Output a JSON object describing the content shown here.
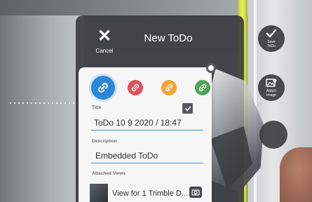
{
  "header": {
    "title": "New ToDo",
    "cancel_label": "Cancel"
  },
  "colors": [
    {
      "name": "link-blue",
      "hex": "#2d86d8",
      "selected": true
    },
    {
      "name": "link-red",
      "hex": "#e0505a",
      "selected": false
    },
    {
      "name": "link-orange",
      "hex": "#f0a332",
      "selected": false
    },
    {
      "name": "link-green",
      "hex": "#52a35a",
      "selected": false
    }
  ],
  "form": {
    "title_label": "Title",
    "title_value": "ToDo 10 9 2020 / 18:47",
    "description_label": "Description",
    "description_value": "Embedded ToDo",
    "attached_label": "Attached Views",
    "attached_item": "View for 1 Trimble D..."
  },
  "side_actions": {
    "save_label_line1": "Save",
    "save_label_line2": "ToDo",
    "attach_label_line1": "Attach",
    "attach_label_line2": "Image"
  },
  "icons": [
    "close-icon",
    "link-icon",
    "checklist-icon",
    "camera-icon",
    "checkmark-icon",
    "attach-image-icon"
  ],
  "accent": "#3f8fe0"
}
